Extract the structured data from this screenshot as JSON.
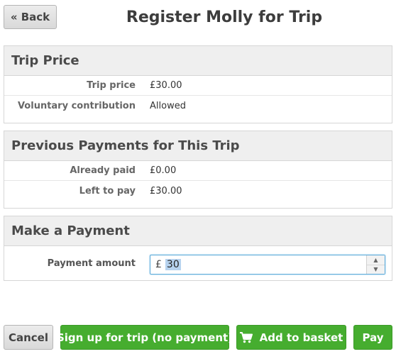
{
  "header": {
    "back_label": "« Back",
    "title": "Register Molly for Trip"
  },
  "trip_price": {
    "heading": "Trip Price",
    "rows": [
      {
        "label": "Trip price",
        "value": "£30.00"
      },
      {
        "label": "Voluntary contribution",
        "value": "Allowed"
      }
    ]
  },
  "previous_payments": {
    "heading": "Previous Payments for This Trip",
    "rows": [
      {
        "label": "Already paid",
        "value": "£0.00"
      },
      {
        "label": "Left to pay",
        "value": "£30.00"
      }
    ]
  },
  "make_payment": {
    "heading": "Make a Payment",
    "amount_label": "Payment amount",
    "currency_symbol": "£",
    "amount_value": "30"
  },
  "footer": {
    "cancel_label": "Cancel",
    "signup_label": "Sign up for trip (no payment)",
    "basket_label": "Add to basket",
    "pay_label": "Pay"
  },
  "colors": {
    "primary_green": "#46ad2f",
    "focus_blue": "#5aa9d8",
    "panel_header_bg": "#efefef"
  },
  "icons": {
    "basket": "shopping-cart-icon",
    "stepper_up": "chevron-up-icon",
    "stepper_down": "chevron-down-icon"
  }
}
